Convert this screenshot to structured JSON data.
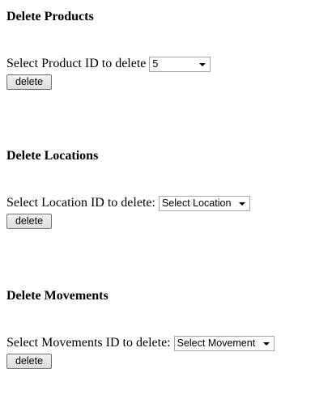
{
  "products": {
    "heading": "Delete Products",
    "label": "Select Product ID to delete",
    "selected_value": "5",
    "button_label": "delete"
  },
  "locations": {
    "heading": "Delete Locations",
    "label": "Select Location ID to delete:",
    "selected_value": "Select Location",
    "button_label": "delete"
  },
  "movements": {
    "heading": "Delete Movements",
    "label": "Select Movements ID to delete:",
    "selected_value": "Select Movement",
    "button_label": "delete"
  },
  "icons": {
    "dropdown_arrow": "chevron-down-icon"
  }
}
